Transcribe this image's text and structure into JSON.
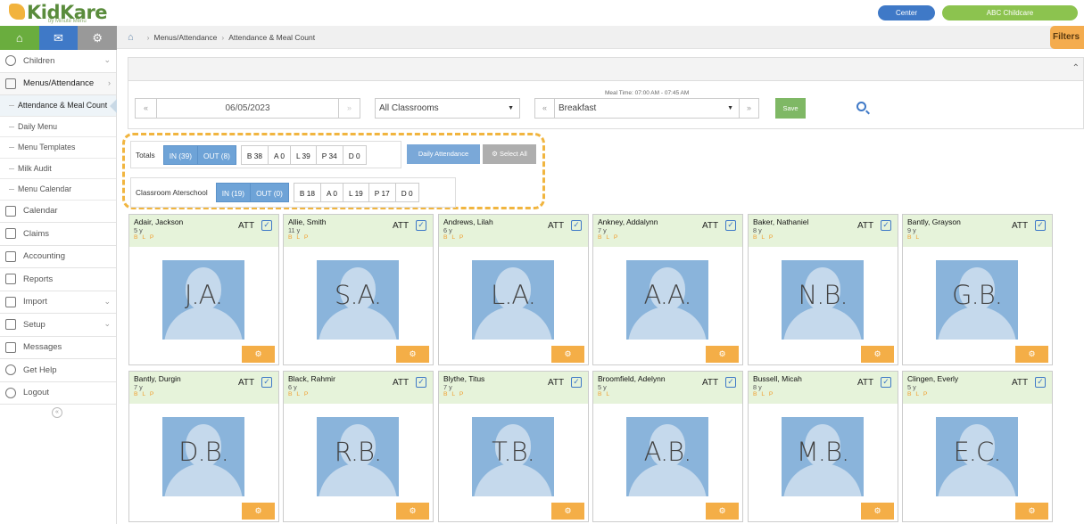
{
  "app": {
    "logo_text": "KidKare",
    "logo_sub": "by Minute Menu"
  },
  "topbar": {
    "center_label": "Center",
    "provider_label": "ABC Childcare"
  },
  "nav": {
    "items": [
      {
        "label": "Children",
        "icon": "child-face-icon"
      },
      {
        "label": "Menus/Attendance",
        "icon": "clipboard-icon"
      },
      {
        "label": "Calendar",
        "icon": "calendar-icon"
      },
      {
        "label": "Claims",
        "icon": "claims-icon"
      },
      {
        "label": "Accounting",
        "icon": "bank-icon"
      },
      {
        "label": "Reports",
        "icon": "report-icon"
      },
      {
        "label": "Import",
        "icon": "import-icon"
      },
      {
        "label": "Setup",
        "icon": "setup-icon"
      },
      {
        "label": "Messages",
        "icon": "envelope-icon"
      },
      {
        "label": "Get Help",
        "icon": "help-icon"
      },
      {
        "label": "Logout",
        "icon": "power-icon"
      }
    ],
    "sub": [
      "Attendance & Meal Count",
      "Daily Menu",
      "Menu Templates",
      "Milk Audit",
      "Menu Calendar"
    ]
  },
  "breadcrumb": {
    "parent": "Menus/Attendance",
    "current": "Attendance & Meal Count"
  },
  "filters_label": "Filters",
  "controls": {
    "date": "06/05/2023",
    "classroom": "All Classrooms",
    "meal_time_label": "Meal Time: 07:00 AM - 07:45 AM",
    "meal": "Breakfast",
    "save_label": "Save"
  },
  "totals": {
    "label": "Totals",
    "in": "IN (39)",
    "out": "OUT (8)",
    "b": "B 38",
    "a": "A 0",
    "l": "L 39",
    "p": "P 34",
    "d": "D 0",
    "daily_attendance_label": "Daily Attendance",
    "select_all_label": "Select All"
  },
  "classroom_totals": {
    "label": "Classroom Aterschool",
    "in": "IN (19)",
    "out": "OUT (0)",
    "b": "B 18",
    "a": "A 0",
    "l": "L 19",
    "p": "P 17",
    "d": "D 0"
  },
  "children": [
    {
      "name": "Adair, Jackson",
      "age": "5 y",
      "meals": "B L P",
      "initials": "J.A."
    },
    {
      "name": "Allie, Smith",
      "age": "11 y",
      "meals": "B L P",
      "initials": "S.A."
    },
    {
      "name": "Andrews, Lilah",
      "age": "6 y",
      "meals": "B L P",
      "initials": "L.A."
    },
    {
      "name": "Ankney, Addalynn",
      "age": "7 y",
      "meals": "B L P",
      "initials": "A.A."
    },
    {
      "name": "Baker, Nathaniel",
      "age": "8 y",
      "meals": "B L P",
      "initials": "N.B."
    },
    {
      "name": "Bantly, Grayson",
      "age": "9 y",
      "meals": "B L",
      "initials": "G.B."
    },
    {
      "name": "Bantly, Durgin",
      "age": "7 y",
      "meals": "B L P",
      "initials": "D.B."
    },
    {
      "name": "Black, Rahmir",
      "age": "6 y",
      "meals": "B L P",
      "initials": "R.B."
    },
    {
      "name": "Blythe, Titus",
      "age": "7 y",
      "meals": "B L P",
      "initials": "T.B."
    },
    {
      "name": "Broomfield, Adelynn",
      "age": "5 y",
      "meals": "B L",
      "initials": "A.B."
    },
    {
      "name": "Bussell, Micah",
      "age": "8 y",
      "meals": "B L P",
      "initials": "M.B."
    },
    {
      "name": "Clingen, Everly",
      "age": "5 y",
      "meals": "B L P",
      "initials": "E.C."
    }
  ],
  "att_label": "ATT",
  "colors": {
    "accent_blue": "#3f79c7",
    "green": "#8cc34f",
    "orange": "#f4ae47",
    "card_header": "#e6f3da"
  }
}
